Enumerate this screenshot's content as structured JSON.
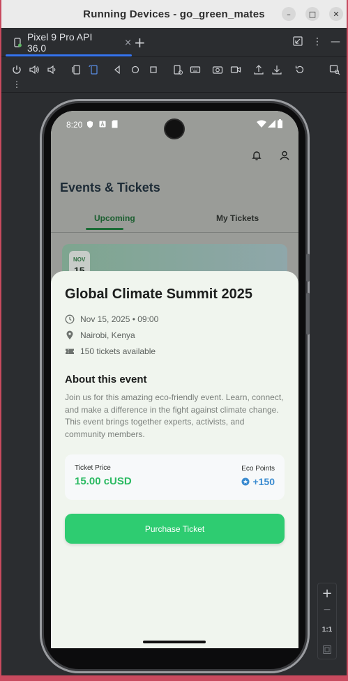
{
  "window": {
    "title": "Running Devices - go_green_mates",
    "min_icon": "minimize-icon",
    "max_icon": "maximize-icon",
    "close_icon": "close-icon"
  },
  "tab": {
    "label": "Pixel 9 Pro API 36.0",
    "close": "×",
    "add": "+"
  },
  "toolbar": {
    "overflow": "⋮"
  },
  "device": {
    "status": {
      "time": "8:20"
    },
    "screen": {
      "page_title": "Events & Tickets",
      "tabs": [
        {
          "label": "Upcoming",
          "active": true
        },
        {
          "label": "My Tickets",
          "active": false
        }
      ],
      "card_date": {
        "month": "NOV",
        "day": "15"
      },
      "sheet": {
        "title": "Global Climate Summit 2025",
        "datetime": "Nov 15, 2025 • 09:00",
        "location": "Nairobi, Kenya",
        "tickets": "150 tickets available",
        "about_heading": "About this event",
        "about_text": "Join us for this amazing eco-friendly event. Learn, connect, and make a difference in the fight against climate change. This event brings together experts, activists, and community members.",
        "price_label": "Ticket Price",
        "price_value": "15.00 cUSD",
        "eco_label": "Eco Points",
        "eco_value": "+150",
        "button_label": "Purchase Ticket"
      }
    }
  },
  "zoom_panel": {
    "plus": "+",
    "minus": "−",
    "ratio": "1:1"
  },
  "colors": {
    "accent": "#2ecc71",
    "price": "#2bba62",
    "eco": "#3a8bd0",
    "tab_indicator": "#3574f0"
  }
}
